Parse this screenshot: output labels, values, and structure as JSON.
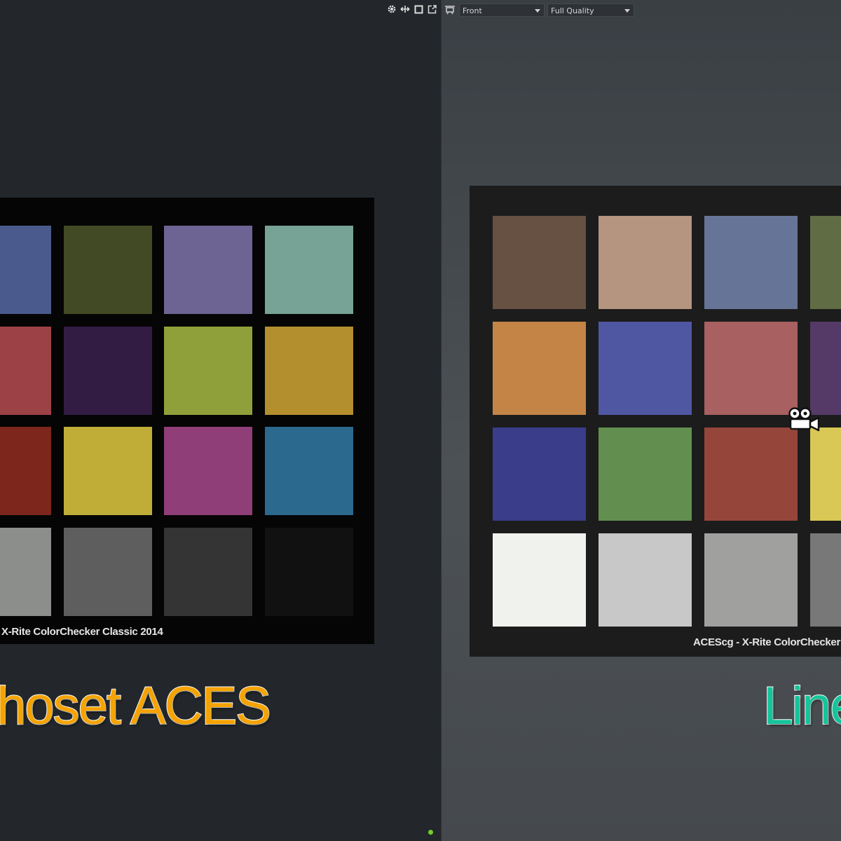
{
  "toolbar_left": {
    "icons": [
      "gear-icon",
      "move-icon",
      "maximize-icon",
      "popout-icon"
    ]
  },
  "toolbar_right": {
    "view_icon": "camera-view-icon",
    "view_dropdown": "Front",
    "quality_dropdown": "Full Quality"
  },
  "left_viewport": {
    "caption": "X-Rite ColorChecker Classic 2014",
    "label": "Ohoset ACES",
    "rows": [
      [
        "#4a5a8c",
        "#414a24",
        "#6e6493",
        "#77a396"
      ],
      [
        "#9c4247",
        "#321c44",
        "#8fa03b",
        "#b38f2d"
      ],
      [
        "#7c261c",
        "#bfad38",
        "#8f3e78",
        "#2b6a8e"
      ],
      [
        "#8c8e8c",
        "#5e5e5e",
        "#343434",
        "#111111"
      ]
    ]
  },
  "right_viewport": {
    "caption": "ACEScg - X-Rite ColorChecker",
    "label": "Linear",
    "rows": [
      [
        "#665142",
        "#b59580",
        "#667597",
        "#606d44"
      ],
      [
        "#c38446",
        "#5057a2",
        "#a86060",
        "#553a67"
      ],
      [
        "#393d8a",
        "#628f50",
        "#96453a",
        "#d9c855"
      ],
      [
        "#f0f2ee",
        "#c8c8c8",
        "#a0a19f",
        "#787878"
      ]
    ]
  },
  "colors": {
    "accent_orange": "#f5a300",
    "accent_teal": "#16c49a",
    "status_green": "#6fcf2a"
  }
}
